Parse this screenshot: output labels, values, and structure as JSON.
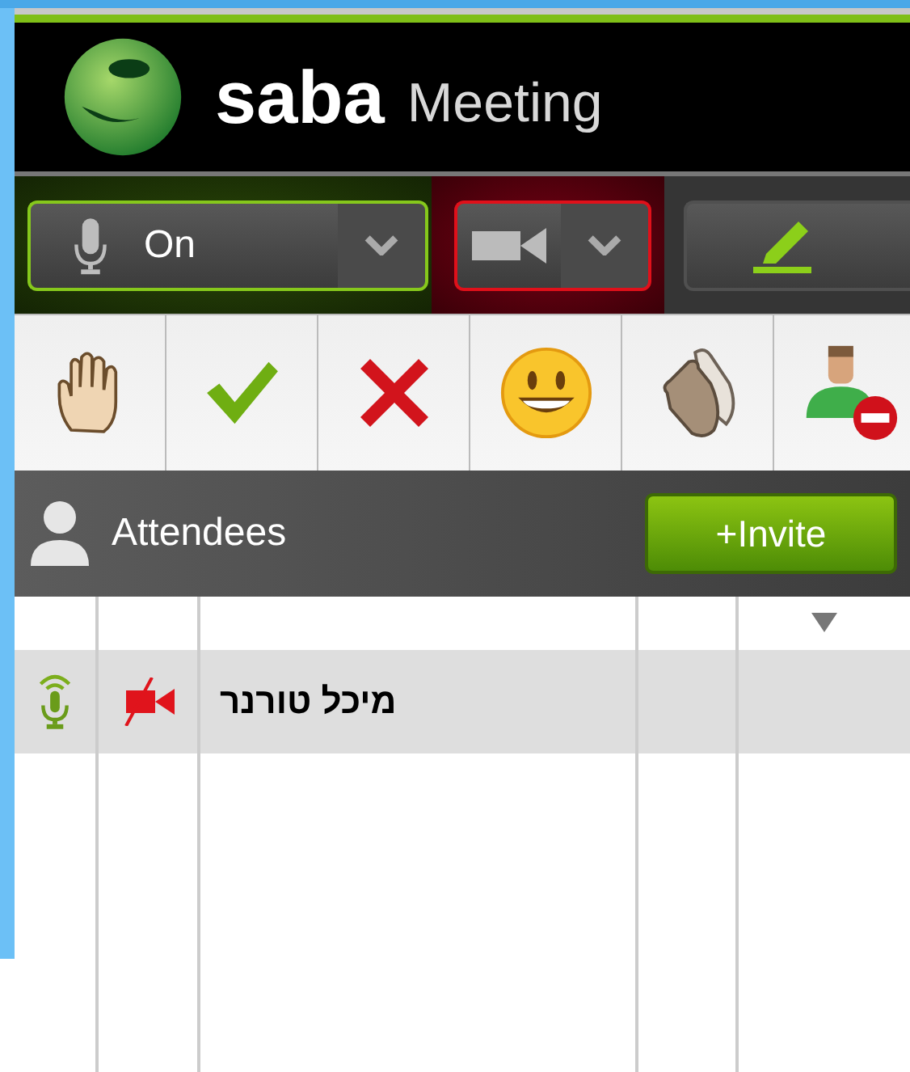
{
  "header": {
    "brand": "saba",
    "product": "Meeting"
  },
  "toolbar": {
    "microphone": {
      "label": "On",
      "active": true
    },
    "camera": {
      "active": false
    }
  },
  "reactions": [
    {
      "kind": "raise-hand"
    },
    {
      "kind": "agree"
    },
    {
      "kind": "disagree"
    },
    {
      "kind": "laugh"
    },
    {
      "kind": "applause"
    },
    {
      "kind": "step-away"
    }
  ],
  "attendees_bar": {
    "title": "Attendees",
    "invite_button": "+Invite"
  },
  "table": {
    "columns": [
      {
        "sorted": false
      },
      {
        "sorted": false
      },
      {
        "sorted": false
      },
      {
        "sorted": false
      },
      {
        "sorted": true
      }
    ],
    "rows": [
      {
        "name": "מיכל טורנר",
        "speaking": true,
        "video": false,
        "selected": true
      }
    ]
  }
}
